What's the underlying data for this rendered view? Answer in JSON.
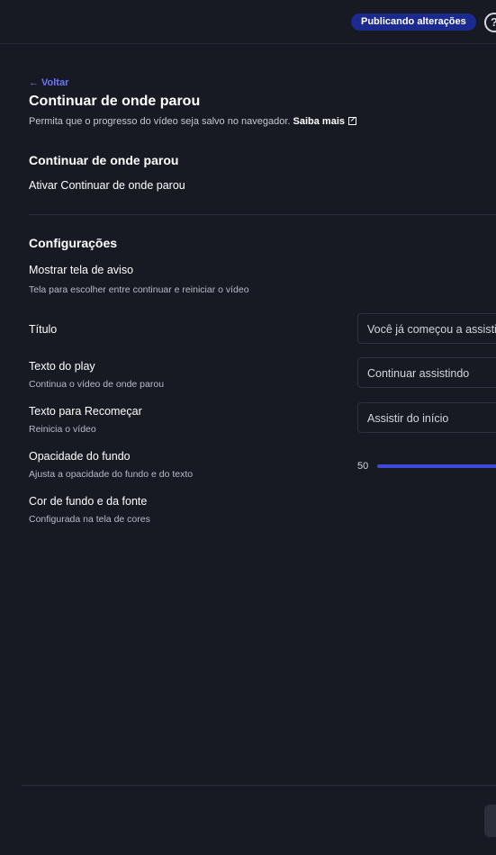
{
  "header": {
    "status_badge": "Publicando alterações",
    "help_icon": "help-circle-icon"
  },
  "page": {
    "back_label": "Voltar",
    "back_arrow": "←",
    "title": "Continuar de onde parou",
    "subtitle": "Permita que o progresso do vídeo seja salvo no navegador.",
    "learn_more": "Saiba mais"
  },
  "section_main": {
    "title": "Continuar de onde parou",
    "toggle_label": "Ativar Continuar de onde parou"
  },
  "section_config": {
    "title": "Configurações",
    "warning_screen": {
      "label": "Mostrar tela de aviso",
      "desc": "Tela para escolher entre continuar e reiniciar o vídeo"
    },
    "title_field": {
      "label": "Título",
      "value": "Você já começou a assistir"
    },
    "play_text": {
      "label": "Texto do play",
      "desc": "Continua o vídeo de onde parou",
      "value": "Continuar assistindo"
    },
    "restart_text": {
      "label": "Texto para Recomeçar",
      "desc": "Reinicia o vídeo",
      "value": "Assistir do início"
    },
    "opacity": {
      "label": "Opacidade do fundo",
      "desc": "Ajusta a opacidade do fundo e do texto",
      "value": "50"
    },
    "colors": {
      "label": "Cor de fundo e da fonte",
      "desc": "Configurada na tela de cores"
    }
  },
  "colors": {
    "background": "#171a23",
    "accent": "#3b4bd8",
    "link": "#6b74ff",
    "badge": "#1b2a8f"
  }
}
